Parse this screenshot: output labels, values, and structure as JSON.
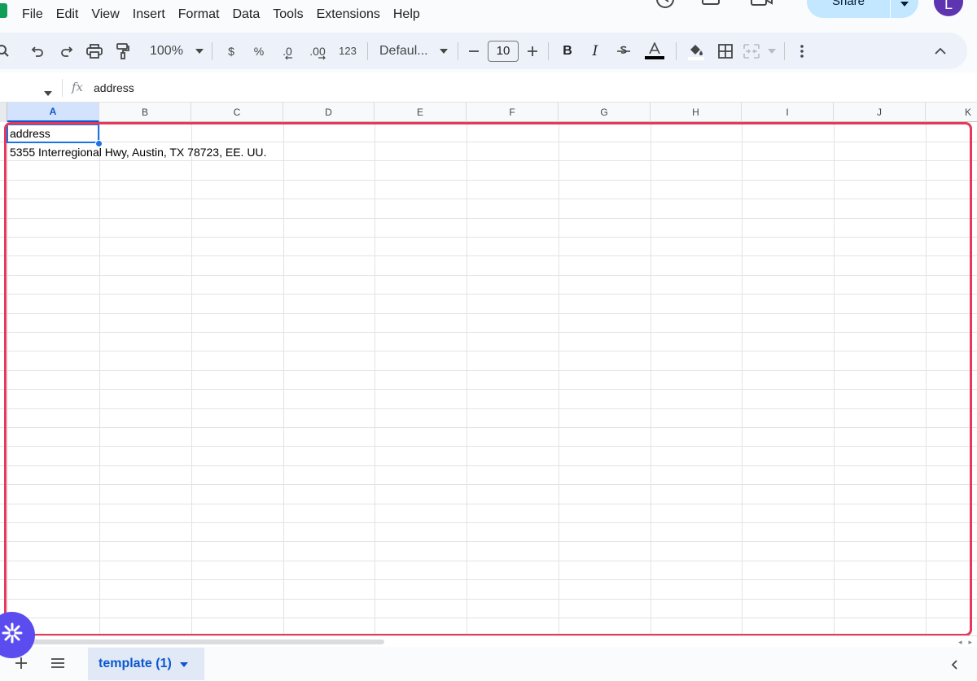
{
  "menu": {
    "items": [
      "File",
      "Edit",
      "View",
      "Insert",
      "Format",
      "Data",
      "Tools",
      "Extensions",
      "Help"
    ]
  },
  "header": {
    "share_label": "Share",
    "avatar_initial": "L"
  },
  "toolbar": {
    "zoom": "100%",
    "currency": "$",
    "percent": "%",
    "decrease_decimal": ".0",
    "increase_decimal": ".00",
    "number_format": "123",
    "font": "Defaul...",
    "font_size": "10",
    "bold": "B",
    "italic": "I"
  },
  "formula_bar": {
    "fx": "fx",
    "value": "address"
  },
  "grid": {
    "columns": [
      "A",
      "B",
      "C",
      "D",
      "E",
      "F",
      "G",
      "H",
      "I",
      "J",
      "K"
    ],
    "active_column": "A",
    "cells": {
      "a1": "address",
      "a2": "5355 Interregional Hwy, Austin, TX 78723, EE. UU."
    }
  },
  "sheets": {
    "active_tab": "template (1)"
  },
  "colors": {
    "accent": "#0b57d0",
    "highlight_frame": "#e8375a",
    "fab": "#5b4cf0"
  },
  "icons": [
    "search-icon",
    "undo-icon",
    "redo-icon",
    "print-icon",
    "paint-format-icon",
    "strikethrough-icon",
    "text-color-icon",
    "fill-color-icon",
    "borders-icon",
    "merge-cells-icon",
    "more-vert-icon",
    "collapse-icon",
    "history-icon",
    "comment-icon",
    "video-call-icon",
    "sheet-list-icon"
  ]
}
